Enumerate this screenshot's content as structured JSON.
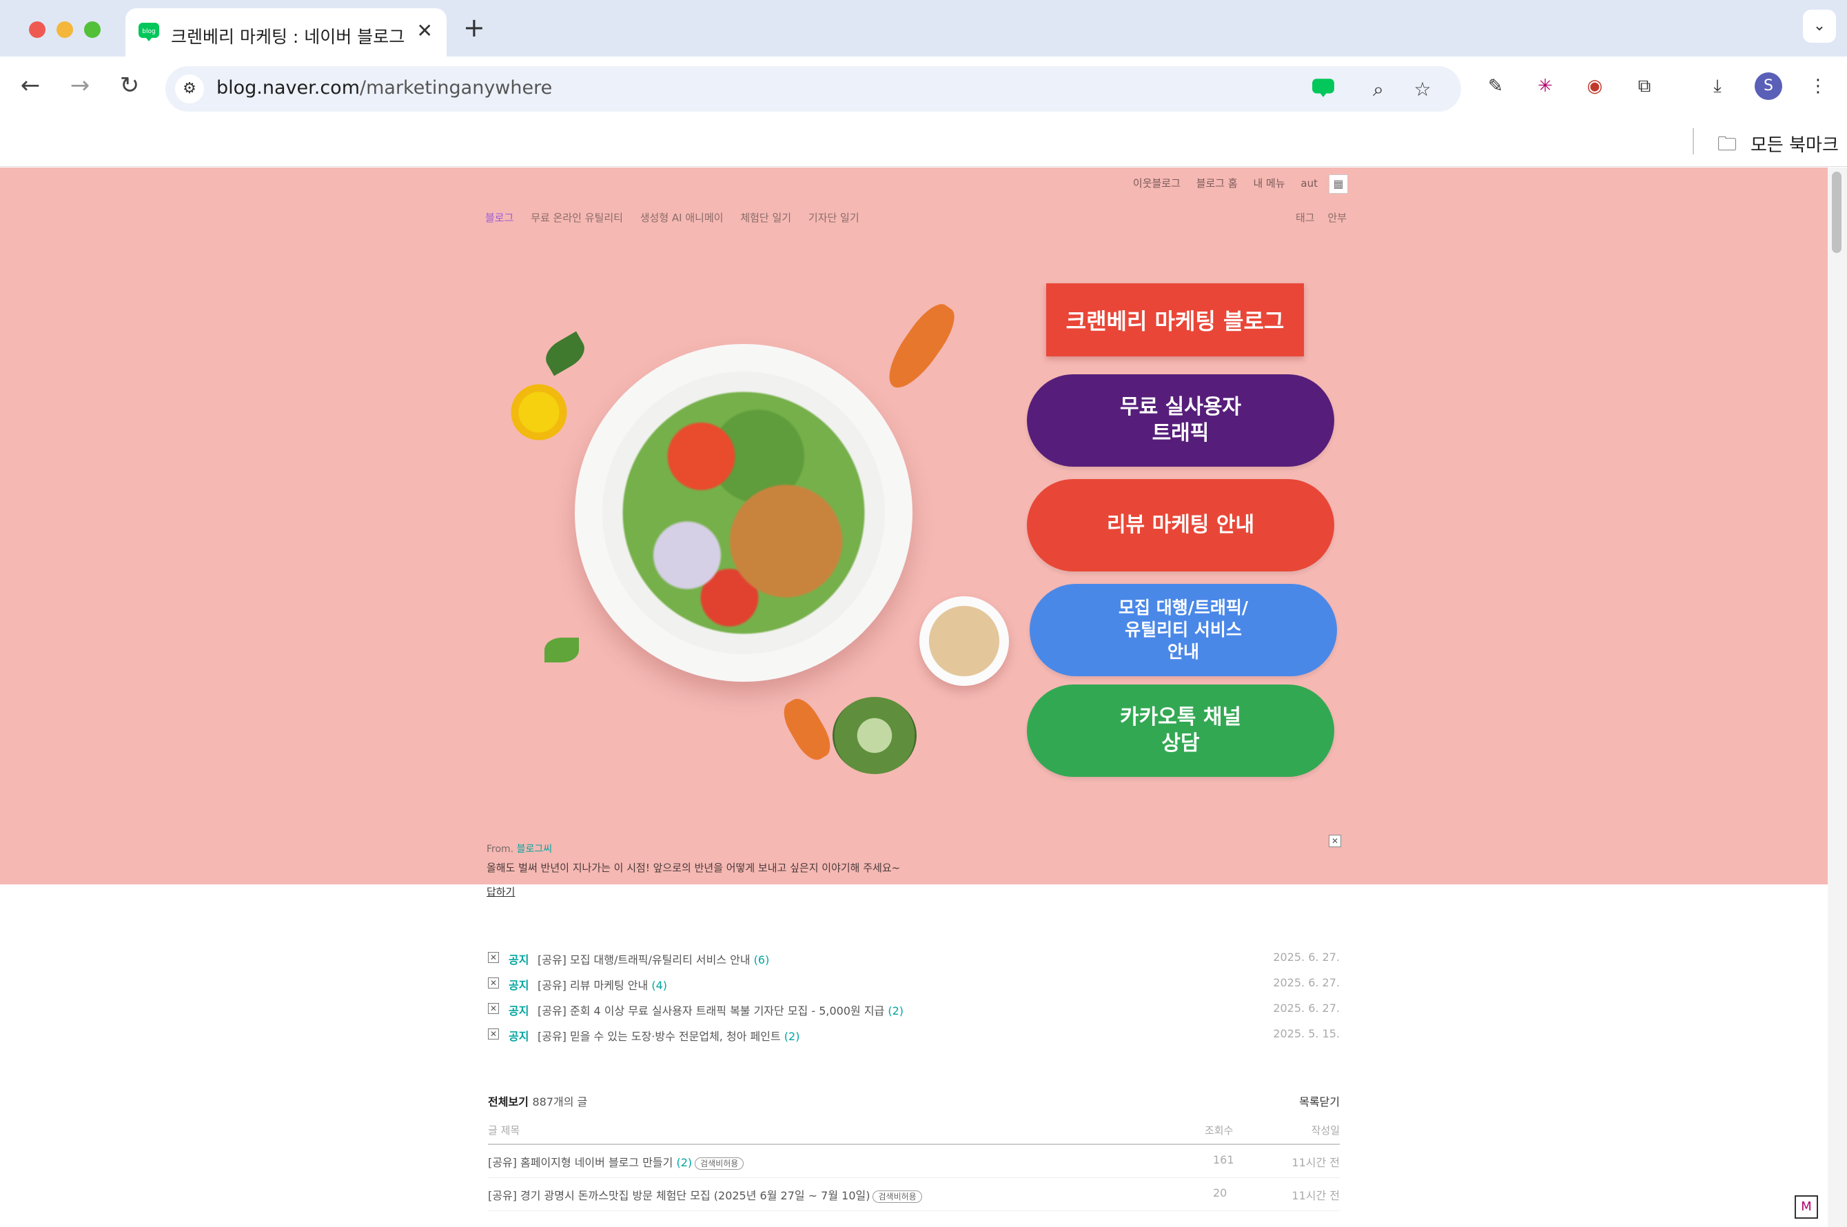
{
  "browser": {
    "tab_title": "크렌베리 마케팅 : 네이버 블로그",
    "new_tab": "+",
    "url_host": "blog.naver.com",
    "url_path": "/marketinganywhere",
    "profile_initial": "S",
    "bookmarks_label": "모든 북마크"
  },
  "gnb": {
    "items": [
      "이웃블로그",
      "블로그 홈",
      "내 메뉴",
      "aut"
    ]
  },
  "blog_menu": {
    "items": [
      "블로그",
      "무료 온라인 유틸리티",
      "생성형 AI 애니메이",
      "체험단 일기",
      "기자단 일기"
    ],
    "right": [
      "태그",
      "안부"
    ]
  },
  "hero": {
    "title_button": "크랜베리 마케팅 블로그",
    "cta": [
      {
        "label": "무료 실사용자\n트래픽",
        "color": "#561e7a"
      },
      {
        "label": "리뷰 마케팅 안내",
        "color": "#e84737"
      },
      {
        "label": "모집 대행/트래픽/\n유틸리티 서비스\n안내",
        "color": "#4a88e8"
      },
      {
        "label": "카카오톡 채널\n상담",
        "color": "#33a853"
      }
    ],
    "accent": "#f5b8b3"
  },
  "from_banner": {
    "prefix": "From.",
    "source": "블로그씨",
    "text": "올해도 벌써 반년이 지나가는 이 시점! 앞으로의 반년을 어떻게 보내고 싶은지 이야기해 주세요~",
    "reply": "답하기"
  },
  "notices": [
    {
      "tag": "공지",
      "title": "[공유] 모집 대행/트래픽/유틸리티 서비스 안내",
      "count": "(6)",
      "date": "2025. 6. 27."
    },
    {
      "tag": "공지",
      "title": "[공유] 리뷰 마케팅 안내",
      "count": "(4)",
      "date": "2025. 6. 27."
    },
    {
      "tag": "공지",
      "title": "[공유] 준회 4 이상 무료 실사용자 트래픽 복불 기자단 모집 - 5,000원 지급",
      "count": "(2)",
      "date": "2025. 6. 27."
    },
    {
      "tag": "공지",
      "title": "[공유] 믿을 수 있는 도장·방수 전문업체, 청아 페인트",
      "count": "(2)",
      "date": "2025. 5. 15."
    }
  ],
  "post_list": {
    "title": "전체보기",
    "count": "887개의 글",
    "close_label": "목록닫기",
    "col_title": "글 제목",
    "col_views": "조회수",
    "col_date": "작성일",
    "rows": [
      {
        "title": "[공유] 홈페이지형 네이버 블로그 만들기",
        "comments": "(2)",
        "badge": "검색비허용",
        "views": "161",
        "date": "11시간 전"
      },
      {
        "title": "[공유] 경기 광명시 돈까스맛집 방문 체험단 모집 (2025년 6월 27일 ~ 7월 10일)",
        "comments": "",
        "badge": "검색비허용",
        "views": "20",
        "date": "11시간 전"
      }
    ]
  }
}
